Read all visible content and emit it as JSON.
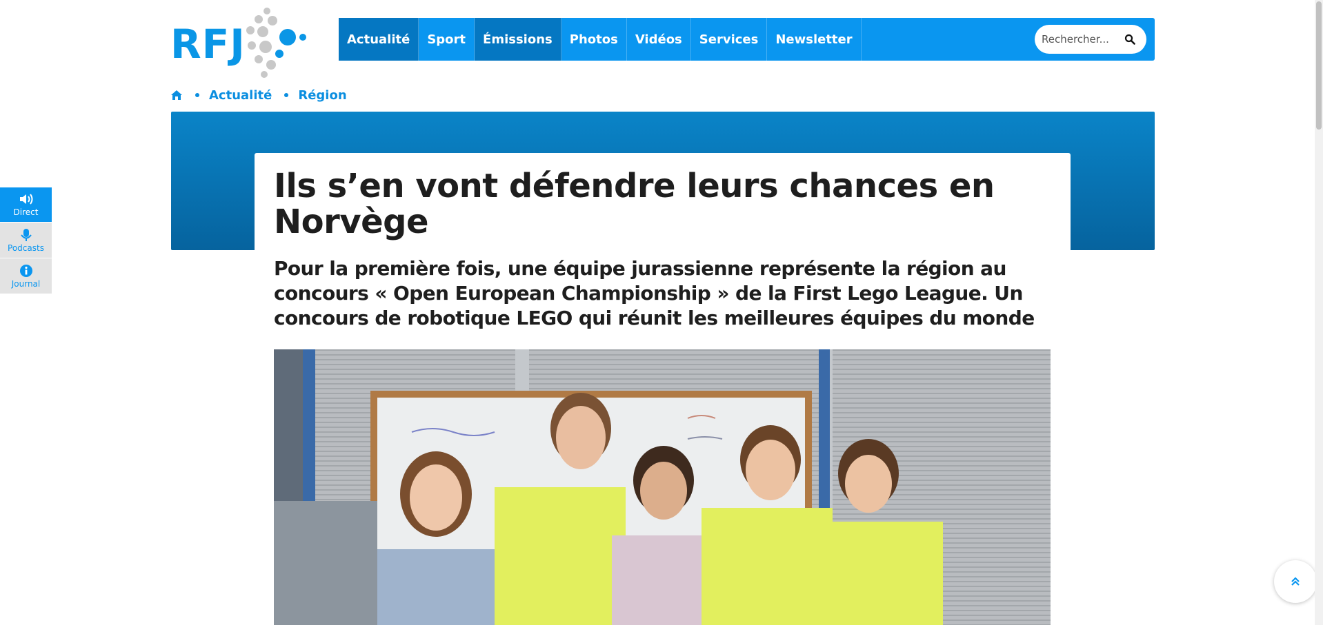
{
  "brand": {
    "logo_text": "RFJ",
    "primary_color": "#0a96f0",
    "dark_blue": "#06639e"
  },
  "nav": {
    "items": [
      {
        "label": "Actualité",
        "active": true
      },
      {
        "label": "Sport",
        "active": false
      },
      {
        "label": "Émissions",
        "active": true
      },
      {
        "label": "Photos",
        "active": false
      },
      {
        "label": "Vidéos",
        "active": false
      },
      {
        "label": "Services",
        "active": false
      },
      {
        "label": "Newsletter",
        "active": false
      }
    ]
  },
  "search": {
    "placeholder": "Rechercher...",
    "icon": "search-icon"
  },
  "breadcrumb": {
    "home_icon": "home-icon",
    "items": [
      "Actualité",
      "Région"
    ]
  },
  "article": {
    "title": "Ils s’en vont défendre leurs chances en Norvège",
    "lead": "Pour la première fois, une équipe jurassienne représente la région au concours « Open European Championship » de la First Lego League. Un concours de robotique LEGO qui réunit les meilleures équipes du monde"
  },
  "sidebar": {
    "items": [
      {
        "label": "Direct",
        "icon": "speaker-icon"
      },
      {
        "label": "Podcasts",
        "icon": "microphone-icon"
      },
      {
        "label": "Journal",
        "icon": "info-icon"
      }
    ]
  },
  "back_to_top": {
    "icon": "chevrons-up-icon"
  }
}
